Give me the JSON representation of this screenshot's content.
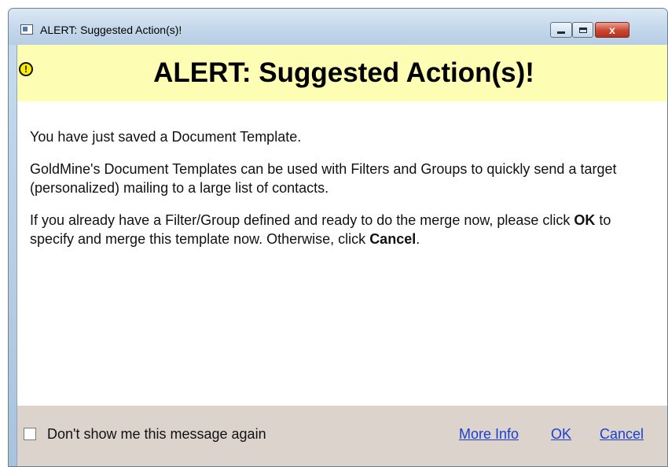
{
  "window": {
    "title": "ALERT: Suggested Action(s)!",
    "close_glyph": "x"
  },
  "banner": {
    "icon": "warning-exclamation-icon",
    "icon_glyph": "!",
    "title": "ALERT: Suggested Action(s)!"
  },
  "body": {
    "p1": "You have just saved a Document Template.",
    "p2": "GoldMine's Document Templates can be used with Filters and Groups to quickly send a target (personalized) mailing to a large list of contacts.",
    "p3_before": "If you already have a Filter/Group defined and ready to do the merge now, please click ",
    "p3_ok": "OK",
    "p3_middle": " to specify and merge this template now. Otherwise, click ",
    "p3_cancel": "Cancel",
    "p3_end": "."
  },
  "footer": {
    "dont_show_label": "Don't show me this message again",
    "dont_show_checked": false,
    "more_info": "More Info",
    "ok": "OK",
    "cancel": "Cancel"
  },
  "colors": {
    "banner_bg": "#fdfdb4",
    "footer_bg": "#ddd3cd",
    "link": "#1a3fd0",
    "close_button": "#c94530"
  }
}
